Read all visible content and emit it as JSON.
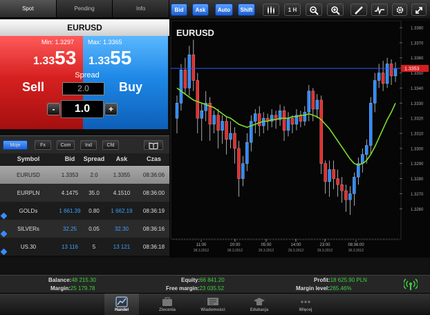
{
  "tabs": [
    {
      "label": "Spot",
      "active": true
    },
    {
      "label": "Pending",
      "active": false
    },
    {
      "label": "Info",
      "active": false
    }
  ],
  "toolbar": {
    "bid": "Bid",
    "ask": "Ask",
    "auto": "Auto",
    "shift": "Shift",
    "timeframe": "1 H"
  },
  "symbol": "EURUSD",
  "sell": {
    "min_label": "Min: 1.3297",
    "price_small": "1.33",
    "price_big": "53",
    "label": "Sell"
  },
  "buy": {
    "max_label": "Max: 1.3365",
    "price_small": "1.33",
    "price_big": "55",
    "label": "Buy"
  },
  "spread": {
    "label": "Spread",
    "value": "2.0"
  },
  "volume": {
    "value": "1.0",
    "minus": "-",
    "plus": "+"
  },
  "filters": [
    "Moje",
    "Fx",
    "Com",
    "Ind",
    "Cfd"
  ],
  "table": {
    "headers": [
      "Symbol",
      "Bid",
      "Spread",
      "Ask",
      "Czas"
    ],
    "rows": [
      {
        "symbol": "EURUSD",
        "bid": "1.3353",
        "spread": "2.0",
        "ask": "1.3355",
        "time": "08:36:06"
      },
      {
        "symbol": "EURPLN",
        "bid": "4.1475",
        "spread": "35.0",
        "ask": "4.1510",
        "time": "08:36:00"
      },
      {
        "symbol": "GOLDs",
        "bid": "1 661.39",
        "spread": "0.80",
        "ask": "1 662.19",
        "time": "08:36:19"
      },
      {
        "symbol": "SILVERs",
        "bid": "32.25",
        "spread": "0.05",
        "ask": "32.30",
        "time": "08:36:16"
      },
      {
        "symbol": "US.30",
        "bid": "13 116",
        "spread": "5",
        "ask": "13 121",
        "time": "08:36:18"
      }
    ]
  },
  "chart_data": {
    "type": "candlestick",
    "title": "EURUSD",
    "ylim": [
      1.324,
      1.338
    ],
    "y_ticks": [
      "1.3380",
      "1.3370",
      "1.3360",
      "1.3350",
      "1.3340",
      "1.3330",
      "1.3320",
      "1.3310",
      "1.3300",
      "1.3290",
      "1.3280",
      "1.3270",
      "1.3260"
    ],
    "current_price_label": "1.3353",
    "current_price": 1.3353,
    "x_ticks": [
      {
        "time": "11:00",
        "date": "28.3.2012"
      },
      {
        "time": "20:00",
        "date": "28.3.2012"
      },
      {
        "time": "05:00",
        "date": "29.3.2012"
      },
      {
        "time": "14:00",
        "date": "29.3.2012"
      },
      {
        "time": "23:00",
        "date": "29.3.2012"
      },
      {
        "time": "08:36:00",
        "date": "30.3.2012"
      }
    ],
    "candles": [
      [
        1.332,
        1.333,
        1.331,
        1.3335
      ],
      [
        1.333,
        1.3352,
        1.3325,
        1.3356
      ],
      [
        1.3352,
        1.334,
        1.3336,
        1.336
      ],
      [
        1.334,
        1.3362,
        1.3335,
        1.3368
      ],
      [
        1.3362,
        1.3345,
        1.3338,
        1.3372
      ],
      [
        1.3345,
        1.332,
        1.331,
        1.335
      ],
      [
        1.332,
        1.3325,
        1.3305,
        1.333
      ],
      [
        1.3325,
        1.333,
        1.3318,
        1.3338
      ],
      [
        1.333,
        1.3316,
        1.3305,
        1.3334
      ],
      [
        1.3316,
        1.3322,
        1.331,
        1.3325
      ],
      [
        1.3322,
        1.3312,
        1.33,
        1.3326
      ],
      [
        1.3312,
        1.3318,
        1.3303,
        1.3322
      ],
      [
        1.3318,
        1.3306,
        1.3296,
        1.3321
      ],
      [
        1.3306,
        1.331,
        1.33,
        1.3318
      ],
      [
        1.331,
        1.33,
        1.329,
        1.3314
      ],
      [
        1.33,
        1.328,
        1.3268,
        1.3305
      ],
      [
        1.328,
        1.329,
        1.3275,
        1.3295
      ],
      [
        1.329,
        1.3304,
        1.3285,
        1.331
      ],
      [
        1.3304,
        1.3318,
        1.3298,
        1.3322
      ],
      [
        1.3318,
        1.3323,
        1.331,
        1.3326
      ],
      [
        1.3323,
        1.3315,
        1.3308,
        1.3328
      ],
      [
        1.3315,
        1.332,
        1.331,
        1.3324
      ],
      [
        1.332,
        1.3318,
        1.3312,
        1.3323
      ],
      [
        1.3318,
        1.3322,
        1.3314,
        1.3326
      ],
      [
        1.3322,
        1.3319,
        1.3313,
        1.3325
      ],
      [
        1.3319,
        1.3325,
        1.3315,
        1.3329
      ],
      [
        1.3325,
        1.3312,
        1.3305,
        1.3328
      ],
      [
        1.3312,
        1.332,
        1.3308,
        1.3324
      ],
      [
        1.332,
        1.3316,
        1.331,
        1.3322
      ],
      [
        1.3316,
        1.3322,
        1.3312,
        1.3326
      ],
      [
        1.3322,
        1.3318,
        1.3314,
        1.3325
      ],
      [
        1.3318,
        1.3324,
        1.3315,
        1.3328
      ],
      [
        1.3324,
        1.3338,
        1.3318,
        1.3342
      ],
      [
        1.3338,
        1.3326,
        1.3318,
        1.334
      ],
      [
        1.3326,
        1.3332,
        1.332,
        1.3336
      ],
      [
        1.3332,
        1.329,
        1.3283,
        1.3335
      ],
      [
        1.329,
        1.3278,
        1.327,
        1.3292
      ],
      [
        1.3278,
        1.3286,
        1.3268,
        1.3292
      ],
      [
        1.3286,
        1.328,
        1.3273,
        1.3292
      ],
      [
        1.328,
        1.3276,
        1.3268,
        1.3286
      ],
      [
        1.3276,
        1.3272,
        1.3264,
        1.3281
      ],
      [
        1.3272,
        1.3266,
        1.3258,
        1.3276
      ],
      [
        1.3266,
        1.327,
        1.3256,
        1.3275
      ],
      [
        1.327,
        1.3281,
        1.3262,
        1.3284
      ],
      [
        1.3281,
        1.329,
        1.3276,
        1.3294
      ],
      [
        1.329,
        1.3296,
        1.3284,
        1.33
      ],
      [
        1.3296,
        1.3302,
        1.329,
        1.3306
      ],
      [
        1.3302,
        1.333,
        1.3296,
        1.3334
      ],
      [
        1.333,
        1.3345,
        1.3324,
        1.335
      ],
      [
        1.3345,
        1.335,
        1.334,
        1.3356
      ],
      [
        1.335,
        1.3343,
        1.3338,
        1.3358
      ],
      [
        1.3343,
        1.3356,
        1.334,
        1.336
      ],
      [
        1.3356,
        1.3348,
        1.3342,
        1.3359
      ],
      [
        1.3348,
        1.3353,
        1.3344,
        1.3357
      ]
    ],
    "ma": [
      1.334,
      1.3338,
      1.3336,
      1.3334,
      1.3332,
      1.3331,
      1.333,
      1.3329,
      1.3328,
      1.3327,
      1.3325,
      1.3323,
      1.3321,
      1.332,
      1.3318,
      1.3316,
      1.3315,
      1.3314,
      1.3315,
      1.3316,
      1.3317,
      1.3318,
      1.3318,
      1.3319,
      1.3319,
      1.332,
      1.332,
      1.332,
      1.3321,
      1.3321,
      1.3322,
      1.3322,
      1.3323,
      1.3322,
      1.3321,
      1.3319,
      1.3316,
      1.3313,
      1.3309,
      1.3305,
      1.3301,
      1.3297,
      1.3293,
      1.329,
      1.3289,
      1.329,
      1.3292,
      1.3296,
      1.3301,
      1.3307,
      1.3313,
      1.3319,
      1.3324,
      1.333
    ]
  },
  "status": {
    "balance_label": "Balance:",
    "balance_value": "48 215.30",
    "margin_label": "Margin:",
    "margin_value": "25 179.78",
    "equity_label": "Equity:",
    "equity_value": "66 841.20",
    "free_margin_label": "Free margin:",
    "free_margin_value": "23 035.52",
    "profit_label": "Profit:",
    "profit_value": "18 625.90 PLN",
    "margin_level_label": "Margin level:",
    "margin_level_value": "265.46%"
  },
  "nav": [
    {
      "label": "Handel",
      "icon": "chart-icon",
      "active": true
    },
    {
      "label": "Zlecenia",
      "icon": "orders-icon",
      "active": false
    },
    {
      "label": "Wiadomości",
      "icon": "news-icon",
      "active": false
    },
    {
      "label": "Edukacja",
      "icon": "education-icon",
      "active": false
    },
    {
      "label": "Więcej",
      "icon": "more-icon",
      "active": false
    }
  ],
  "colors": {
    "sell": "#d62020",
    "buy": "#1e88e6",
    "accent": "#2a7cff",
    "ma": "#7ddf2a",
    "positive": "#3cd33c"
  }
}
